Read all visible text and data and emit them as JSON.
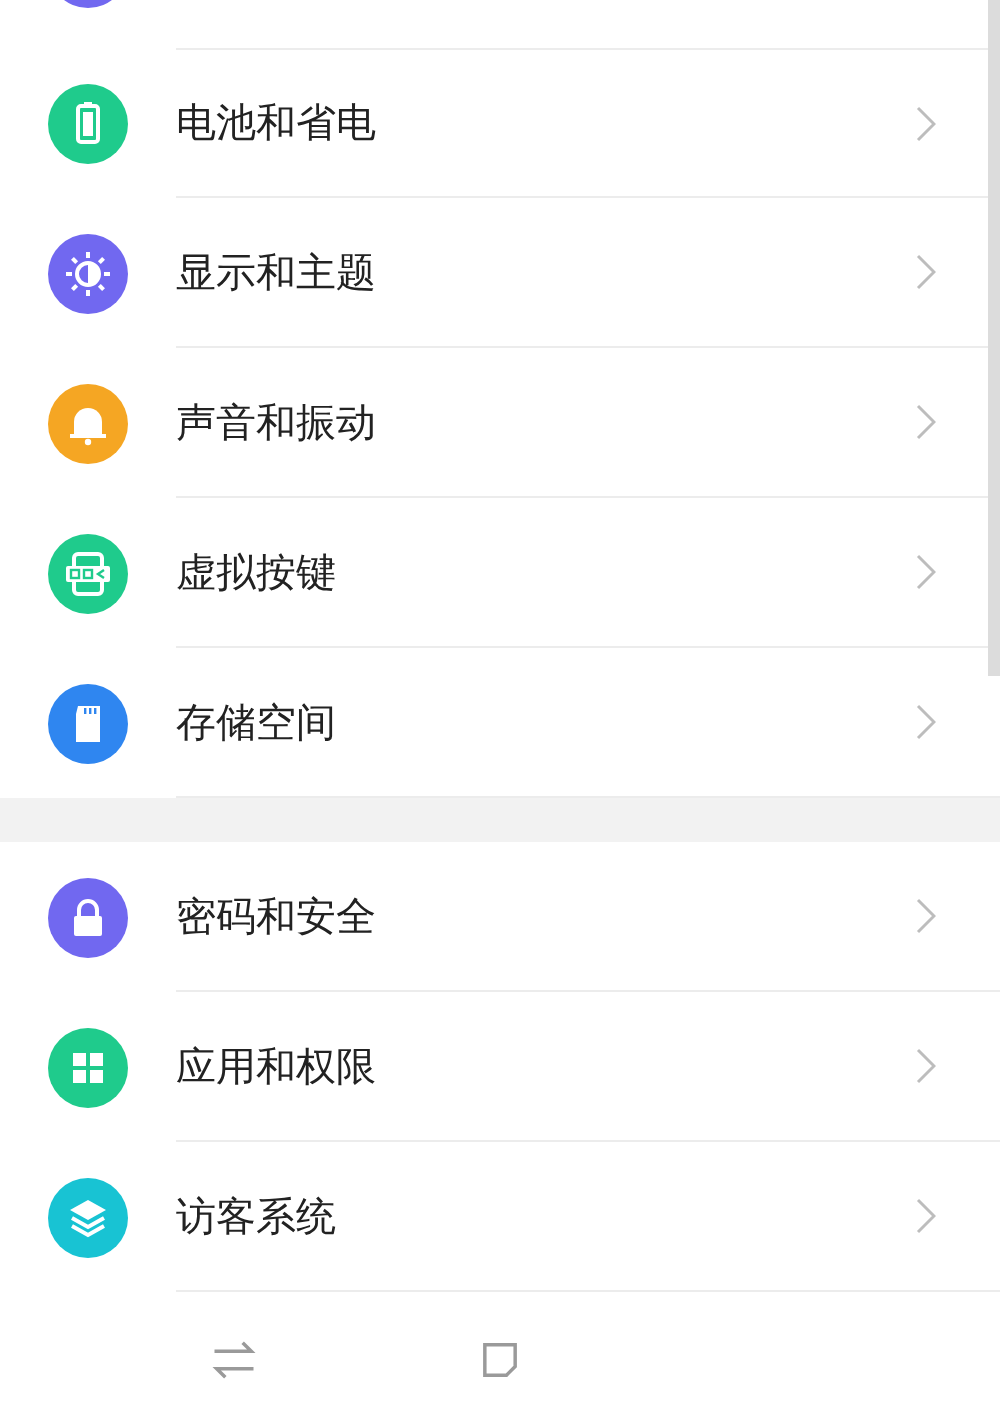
{
  "partial_top_item": {
    "color": "#7168f0"
  },
  "groups": [
    {
      "items": [
        {
          "label": "电池和省电",
          "color": "#1fcb8c"
        },
        {
          "label": "显示和主题",
          "color": "#7168f0"
        },
        {
          "label": "声音和振动",
          "color": "#f5a623"
        },
        {
          "label": "虚拟按键",
          "color": "#1fcb8c"
        },
        {
          "label": "存储空间",
          "color": "#2f86f0"
        }
      ]
    },
    {
      "items": [
        {
          "label": "密码和安全",
          "color": "#7168f0"
        },
        {
          "label": "应用和权限",
          "color": "#1fcb8c"
        },
        {
          "label": "访客系统",
          "color": "#18c3d3"
        }
      ]
    }
  ]
}
